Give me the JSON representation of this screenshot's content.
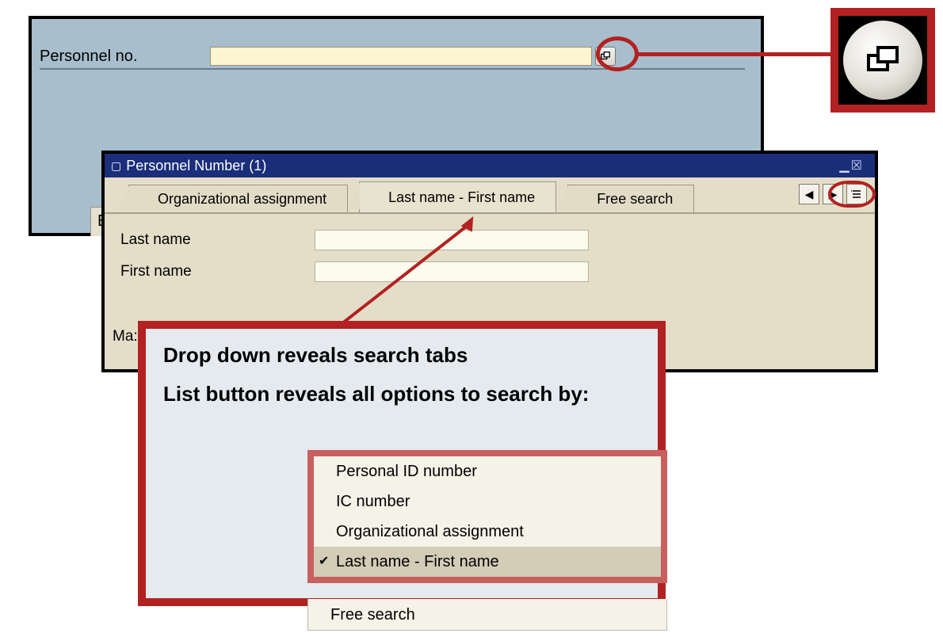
{
  "main": {
    "field_label": "Personnel no.",
    "truncated_tab": "Er"
  },
  "dialog": {
    "title": "Personnel Number (1)",
    "tabs": [
      "Organizational assignment",
      "Last name - First name",
      "Free search"
    ],
    "form": {
      "last_name_label": "Last name",
      "first_name_label": "First name"
    },
    "truncated_label": "Ma:",
    "nav_left": "◀",
    "nav_right": "▶"
  },
  "callout": {
    "line1": "Drop down reveals search tabs",
    "line2": "List button reveals all options to search by:"
  },
  "menu": {
    "items": [
      {
        "label": "Personal ID number",
        "selected": false
      },
      {
        "label": "IC number",
        "selected": false
      },
      {
        "label": "Organizational assignment",
        "selected": false
      },
      {
        "label": "Last name - First name",
        "selected": true
      }
    ],
    "extra": "Free search"
  }
}
